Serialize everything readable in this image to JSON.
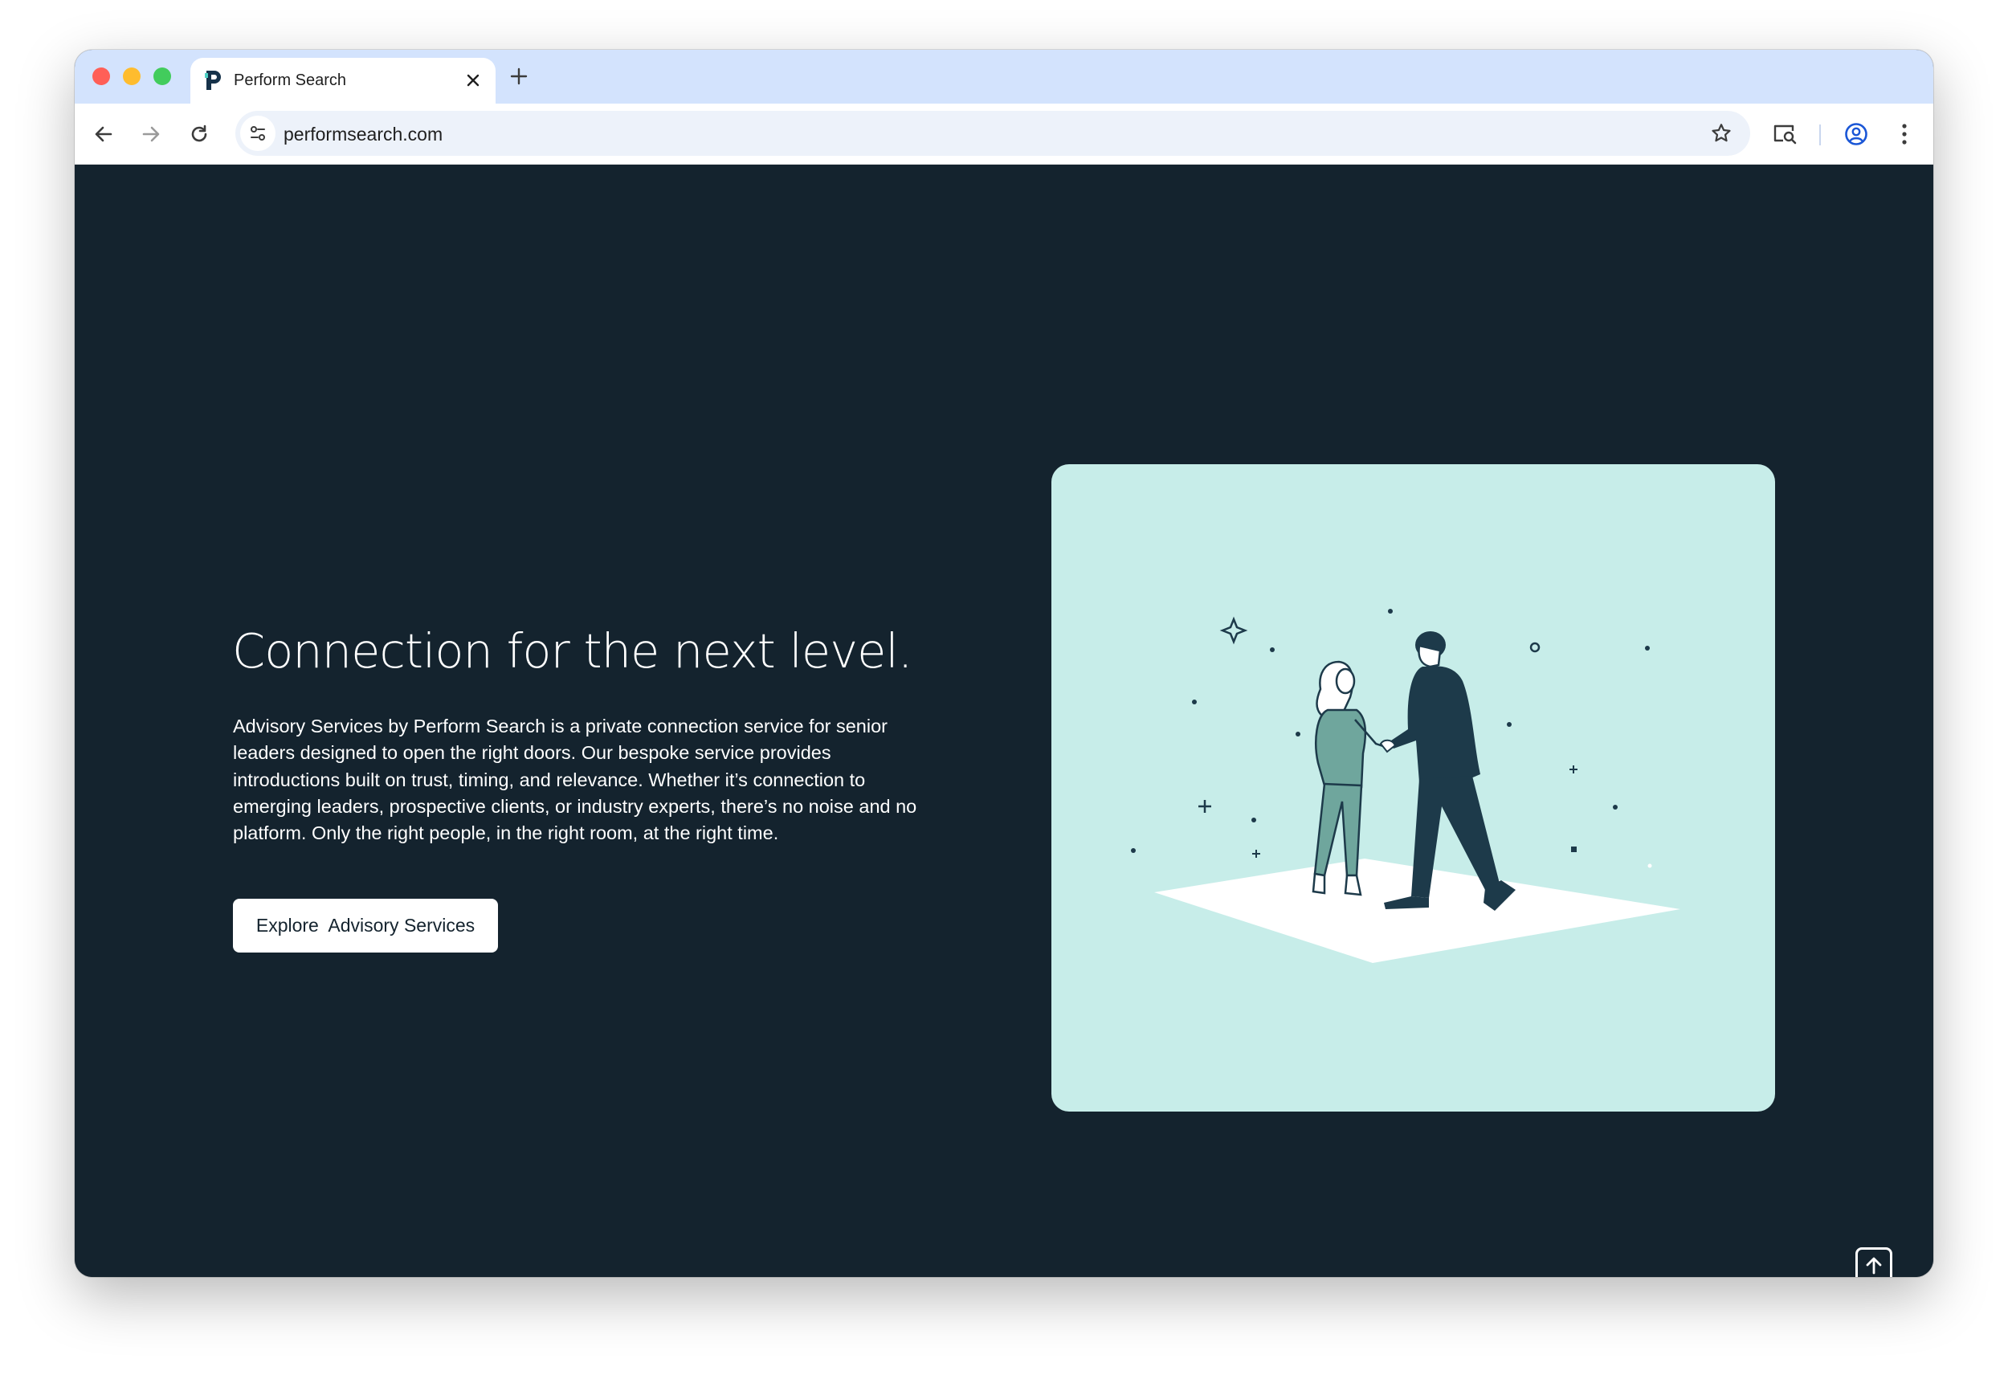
{
  "browser": {
    "tab": {
      "favicon": "P",
      "title": "Perform Search"
    },
    "address_bar": {
      "url": "performsearch.com"
    },
    "icons": {
      "back": "back-arrow-icon",
      "forward": "forward-arrow-icon",
      "reload": "reload-icon",
      "site_info": "tune-icon",
      "bookmark": "star-icon",
      "lens": "lens-search-icon",
      "profile": "profile-icon",
      "menu": "kebab-menu-icon"
    }
  },
  "hero": {
    "headline": "Connection for the next level.",
    "description": "Advisory Services by Perform Search is a private connection service for senior leaders designed to open the right doors. Our bespoke service provides introductions built on trust, timing, and relevance. Whether it’s connection to emerging leaders, prospective clients, or industry experts, there’s no noise and no platform. Only the right people, in the right room, at the right time.",
    "cta_label": "Explore  Advisory Services"
  },
  "illustration": {
    "subject": "handshake-illustration",
    "background_color": "#c7ede9",
    "figure_color": "#1d3a4a"
  },
  "colors": {
    "page_background": "#14232e",
    "tab_strip": "#d3e3fd",
    "accent": "#c7ede9"
  }
}
